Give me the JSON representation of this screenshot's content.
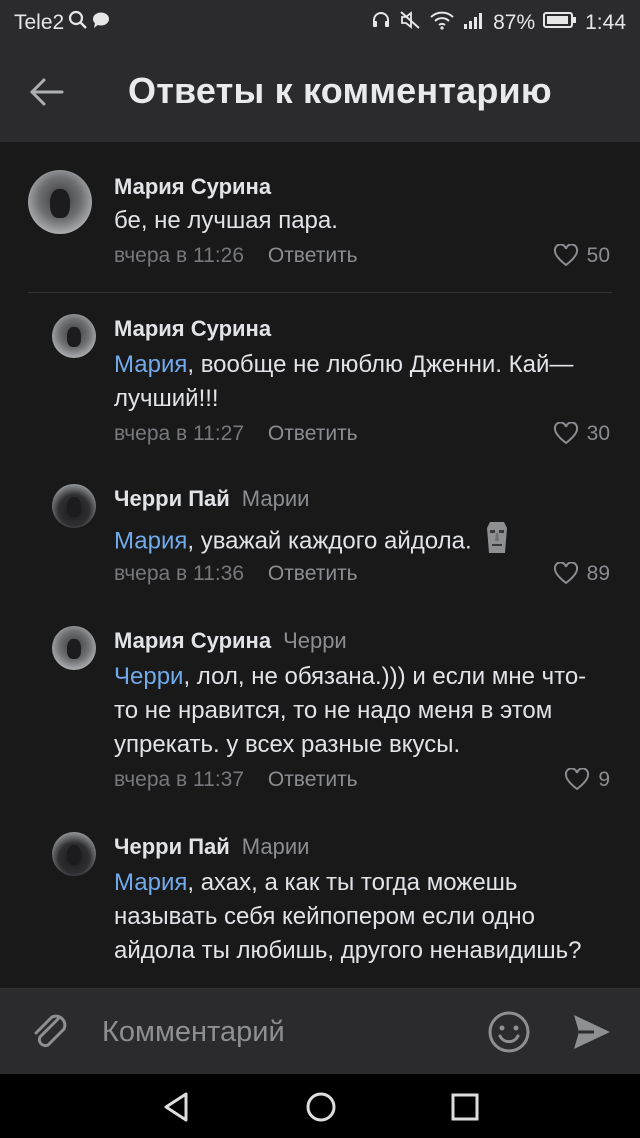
{
  "status_bar": {
    "carrier": "Tele2",
    "battery": "87%",
    "time": "1:44"
  },
  "header": {
    "title": "Ответы к комментарию"
  },
  "comments": [
    {
      "author": "Мария Сурина",
      "reply_to": "",
      "mention": "",
      "text": "бе, не лучшая пара.",
      "time": "вчера в 11:26",
      "reply_label": "Ответить",
      "likes": "50"
    },
    {
      "author": "Мария Сурина",
      "reply_to": "",
      "mention": "Мария",
      "text": ", вообще не люблю Дженни. Кай— лучший!!!",
      "time": "вчера в 11:27",
      "reply_label": "Ответить",
      "likes": "30"
    },
    {
      "author": "Черри Пай",
      "reply_to": "Марии",
      "mention": "Мария",
      "text": ", уважай каждого айдола.",
      "emoji": "moai-icon",
      "time": "вчера в 11:36",
      "reply_label": "Ответить",
      "likes": "89"
    },
    {
      "author": "Мария Сурина",
      "reply_to": "Черри",
      "mention": "Черри",
      "text": ", лол, не обязана.))) и если мне что-то не нравится, то не надо меня в этом упрекать. у всех разные вкусы.",
      "time": "вчера в 11:37",
      "reply_label": "Ответить",
      "likes": "9"
    },
    {
      "author": "Черри Пай",
      "reply_to": "Марии",
      "mention": "Мария",
      "text": ", ахах, а как ты тогда можешь называть себя кейпопером если одно айдола ты любишь, другого ненавидишь?",
      "time": "",
      "reply_label": "",
      "likes": ""
    }
  ],
  "composer": {
    "placeholder": "Комментарий"
  },
  "colors": {
    "background": "#19191a",
    "bar": "#2b2b2d",
    "mention": "#71aaeb",
    "meta": "#76787b"
  }
}
